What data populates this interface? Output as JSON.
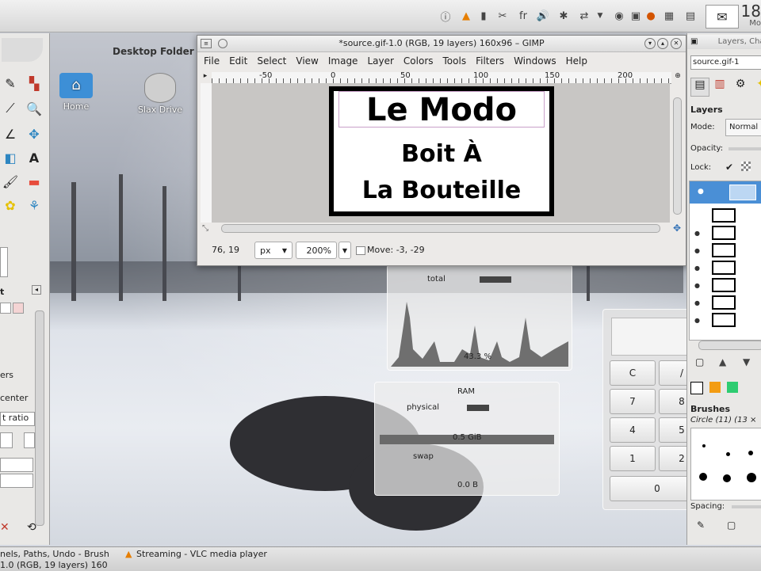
{
  "panel": {
    "clock_time": "18",
    "clock_sub": "Mo",
    "tray_lang": "fr"
  },
  "desktop": {
    "folder_title": "Desktop Folder",
    "icons": [
      {
        "label": "Home"
      },
      {
        "label": "Slax Drive"
      }
    ]
  },
  "gimp": {
    "title": "*source.gif-1.0 (RGB, 19 layers) 160x96 – GIMP",
    "menu": [
      "File",
      "Edit",
      "Select",
      "View",
      "Image",
      "Layer",
      "Colors",
      "Tools",
      "Filters",
      "Windows",
      "Help"
    ],
    "ruler_marks": [
      "-50",
      "0",
      "50",
      "100",
      "150",
      "200"
    ],
    "image_text": {
      "line1": "Le Modo",
      "line2": "Boit À",
      "line3": "La Bouteille"
    },
    "status": {
      "coords": "76, 19",
      "unit": "px",
      "zoom": "200%",
      "message": "Move: -3, -29"
    }
  },
  "toolbox": {
    "labels": [
      "t",
      "ers",
      "center",
      "t ratio"
    ]
  },
  "layers": {
    "tab_title": "Layers, Cha",
    "image_select": "source.gif-1",
    "header": "Layers",
    "mode_label": "Mode:",
    "mode_value": "Normal",
    "opacity_label": "Opacity:",
    "lock_label": "Lock:",
    "brushes_header": "Brushes",
    "brush_name": "Circle (11) (13 ×",
    "spacing_label": "Spacing:"
  },
  "monitor": {
    "cpu_label": "total",
    "cpu_value": "43.3 %",
    "ram_title": "RAM",
    "ram_physical": "physical",
    "ram_physical_value": "0.5 GiB",
    "ram_swap": "swap",
    "ram_swap_value": "0.0 B"
  },
  "calculator": {
    "buttons": [
      "C",
      "/",
      "7",
      "8",
      "4",
      "5",
      "1",
      "2",
      "0"
    ]
  },
  "taskbar": {
    "items": [
      {
        "label": "nels, Paths, Undo - Brush"
      },
      {
        "label": "Streaming - VLC media player"
      },
      {
        "label": "1.0 (RGB, 19 layers) 160"
      }
    ]
  }
}
